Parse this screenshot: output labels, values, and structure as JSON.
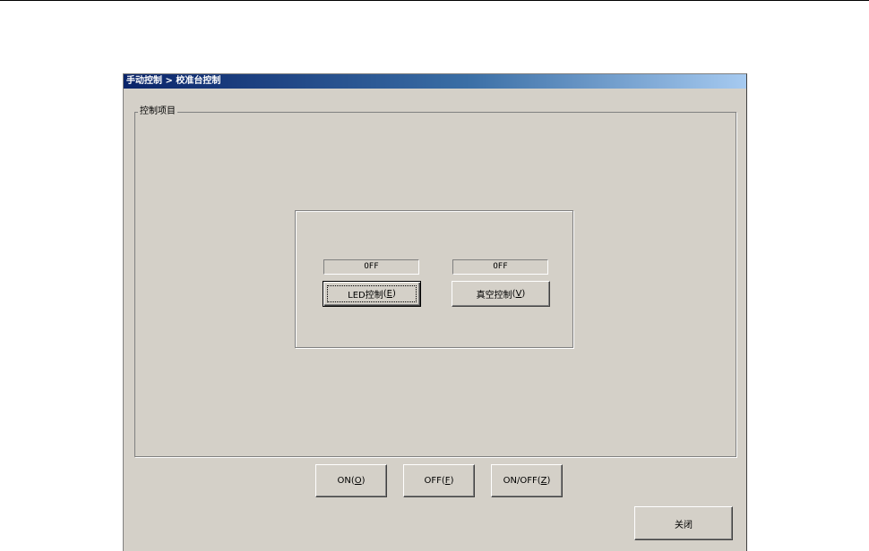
{
  "window": {
    "title": "手动控制 > 校准台控制"
  },
  "group": {
    "legend": "控制项目"
  },
  "controls": [
    {
      "status": "OFF",
      "label": "LED控制",
      "mnemonic_open": "(",
      "mnemonic": "E",
      "mnemonic_close": ")"
    },
    {
      "status": "OFF",
      "label": "真空控制",
      "mnemonic_open": "(",
      "mnemonic": "V",
      "mnemonic_close": ")"
    }
  ],
  "actions": {
    "on": {
      "label": "ON",
      "mnemonic_open": "(",
      "mnemonic": "O",
      "mnemonic_close": ")"
    },
    "off": {
      "label": "OFF",
      "mnemonic_open": "(",
      "mnemonic": "F",
      "mnemonic_close": ")"
    },
    "onoff": {
      "label": "ON/OFF",
      "mnemonic_open": "(",
      "mnemonic": "Z",
      "mnemonic_close": ")"
    },
    "close": {
      "label": "关闭"
    }
  }
}
